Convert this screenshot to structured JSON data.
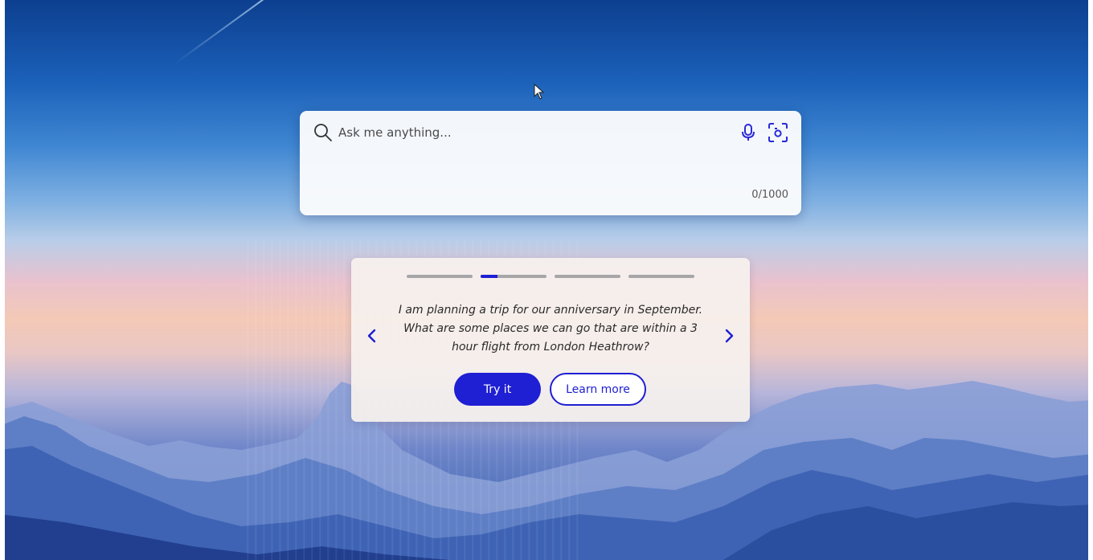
{
  "search": {
    "placeholder": "Ask me anything...",
    "value": "",
    "char_count": "0/1000",
    "icons": {
      "search": "search-icon",
      "mic": "microphone-icon",
      "visual": "visual-search-icon"
    }
  },
  "suggestion": {
    "text": "I am planning a trip for our anniversary in September. What are some places we can go that are within a 3 hour flight from London Heathrow?",
    "try_label": "Try it",
    "learn_label": "Learn more",
    "progress": {
      "total": 4,
      "active_index": 1,
      "active_fill": 0.25
    },
    "icons": {
      "prev": "chevron-left-icon",
      "next": "chevron-right-icon"
    }
  },
  "colors": {
    "accent": "#1f1fd3",
    "accent_text": "#ffffff",
    "progress_inactive": "#a8a5a8"
  }
}
